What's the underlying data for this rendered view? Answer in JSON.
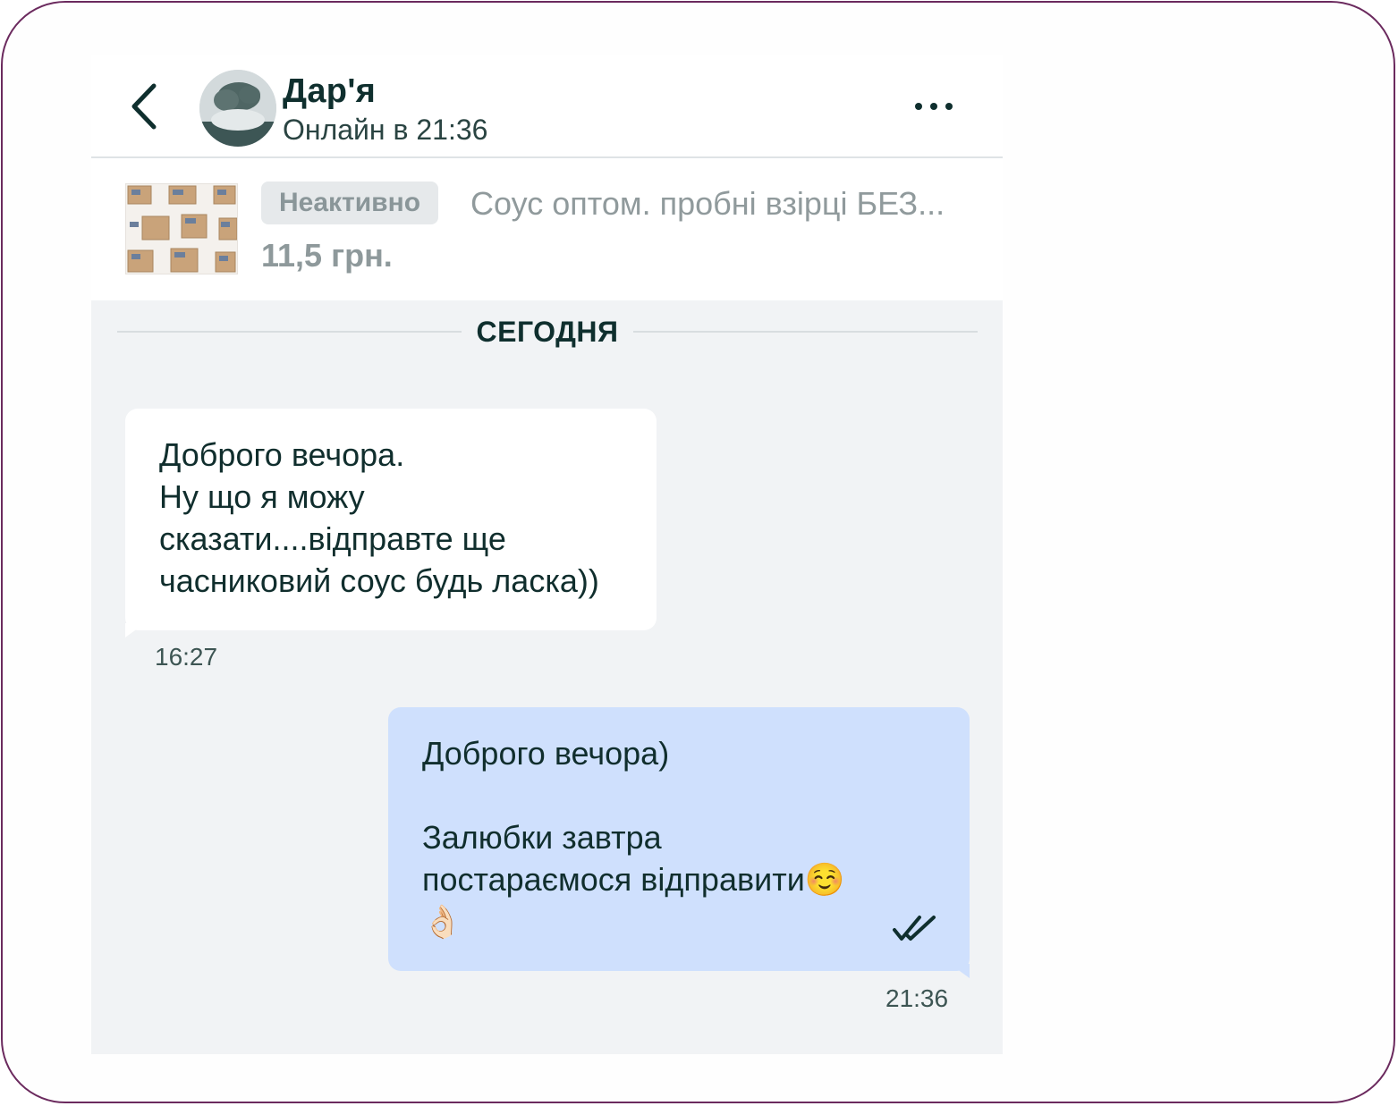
{
  "header": {
    "contact_name": "Дар'я",
    "status": "Онлайн в 21:36",
    "back_icon": "chevron-left-icon",
    "menu_icon": "more-horizontal-icon"
  },
  "offer": {
    "status_badge": "Неактивно",
    "title": "Соус оптом. пробні взірці БЕЗ...",
    "price": "11,5 грн."
  },
  "date_separator": "СЕГОДНЯ",
  "messages": [
    {
      "direction": "incoming",
      "text": "Доброго вечора.\nНу що я можу\nсказати....відправте ще\nчасниковий соус будь ласка))",
      "time": "16:27"
    },
    {
      "direction": "outgoing",
      "text": "Доброго вечора)\n\nЗалюбки завтра\nпостараємося відправити☺️\n👌🏻",
      "time": "21:36",
      "read_icon": "double-check-icon"
    }
  ],
  "colors": {
    "frame_border": "#6b2a5e",
    "chat_background": "#f1f3f5",
    "incoming_bubble": "#ffffff",
    "outgoing_bubble": "#cfe0fd",
    "text_primary": "#0f2f2e"
  }
}
